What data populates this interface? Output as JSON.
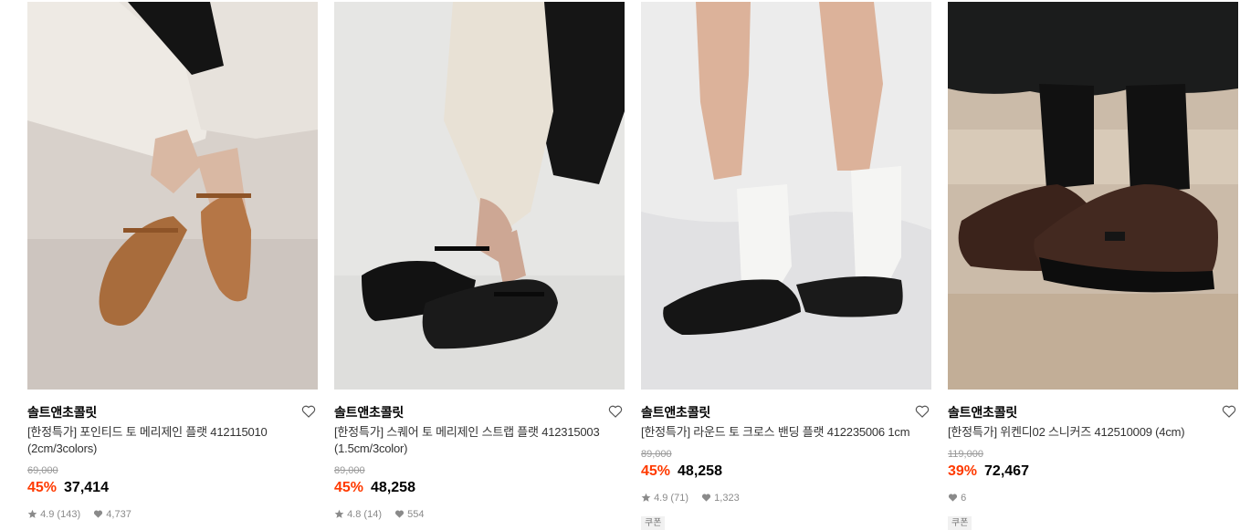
{
  "products": [
    {
      "brand": "솔트앤초콜릿",
      "title": "[한정특가] 포인티드 토 메리제인 플랫 412115010 (2cm/3colors)",
      "original_price": "69,000",
      "discount": "45%",
      "price": "37,414",
      "rating": "4.9",
      "reviews": "(143)",
      "likes": "4,737",
      "coupon": ""
    },
    {
      "brand": "솔트앤초콜릿",
      "title": "[한정특가] 스퀘어 토 메리제인 스트랩 플랫 412315003 (1.5cm/3color)",
      "original_price": "89,000",
      "discount": "45%",
      "price": "48,258",
      "rating": "4.8",
      "reviews": "(14)",
      "likes": "554",
      "coupon": ""
    },
    {
      "brand": "솔트앤초콜릿",
      "title": "[한정특가] 라운드 토 크로스 밴딩 플랫 412235006 1cm",
      "original_price": "89,000",
      "discount": "45%",
      "price": "48,258",
      "rating": "4.9",
      "reviews": "(71)",
      "likes": "1,323",
      "coupon": "쿠폰"
    },
    {
      "brand": "솔트앤초콜릿",
      "title": "[한정특가] 위켄디02 스니커즈 412510009 (4cm)",
      "original_price": "119,000",
      "discount": "39%",
      "price": "72,467",
      "rating": "",
      "reviews": "",
      "likes": "6",
      "coupon": "쿠폰"
    }
  ],
  "colors": {
    "discount": "#ff3a00",
    "muted": "#999999",
    "coupon_bg": "#f1f1f1"
  },
  "icons": {
    "like": "heart-outline-icon",
    "rating": "star-icon",
    "likes": "heart-filled-icon"
  }
}
